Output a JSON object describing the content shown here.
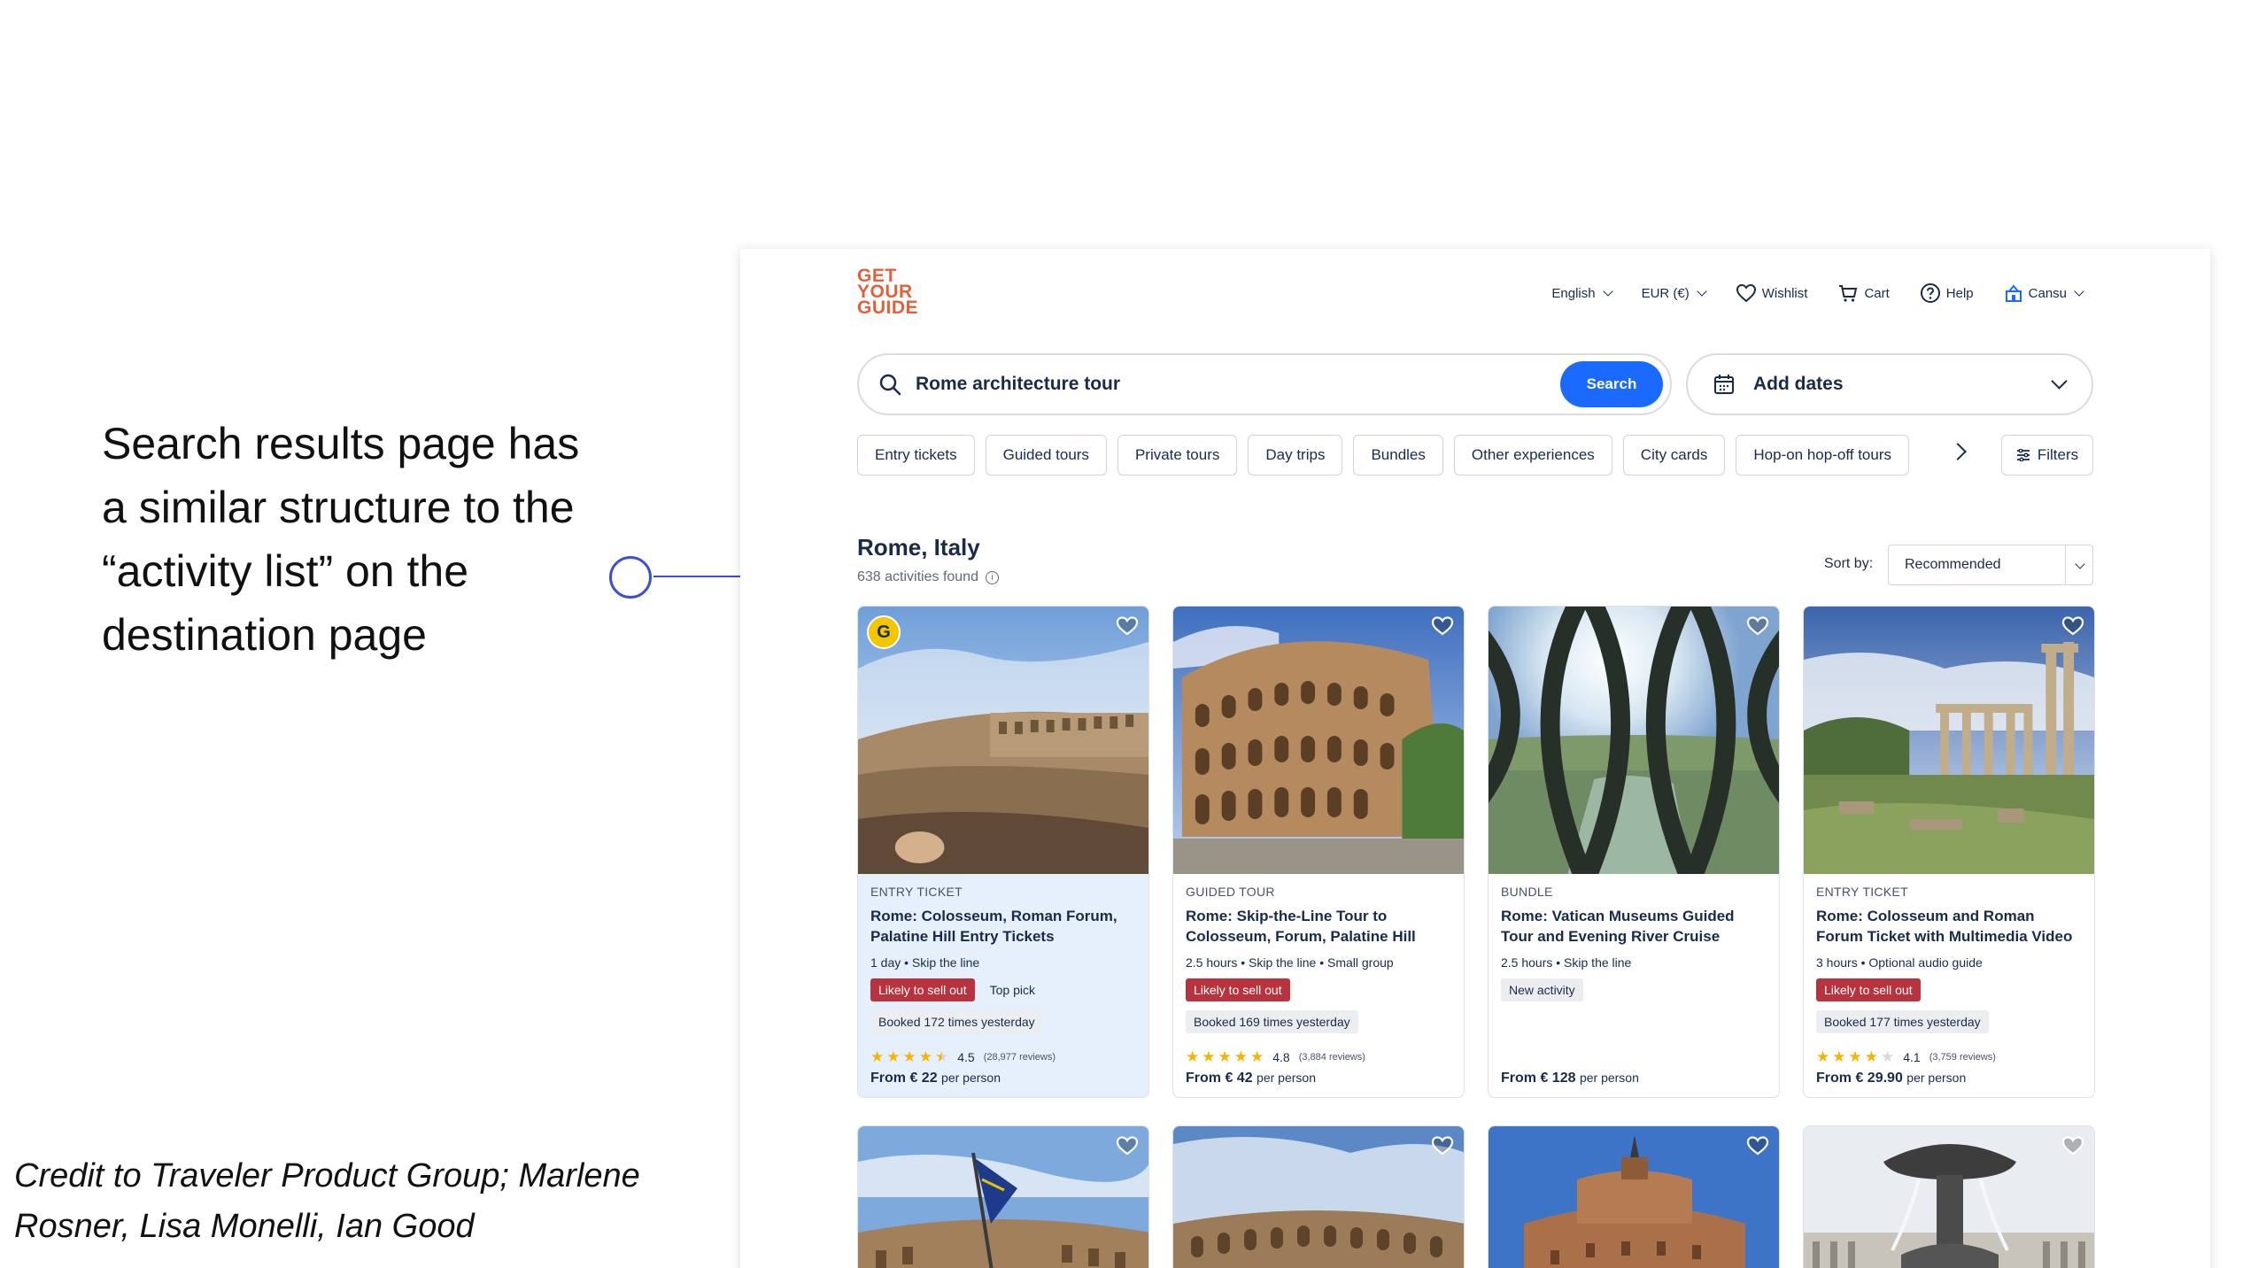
{
  "slide": {
    "caption": "Search results page has a similar structure to the “activity list” on the destination page",
    "credit": "Credit to Traveler Product Group; Marlene Rosner, Lisa Monelli, Ian Good",
    "connector_color": "#3d4fd6"
  },
  "app": {
    "logo_lines": [
      "GET",
      "YOUR",
      "GUIDE"
    ],
    "brand_color": "#e0613b",
    "accent_color": "#1a6aff"
  },
  "header": {
    "language": "English",
    "currency": "EUR (€)",
    "wishlist": "Wishlist",
    "cart": "Cart",
    "help": "Help",
    "user": "Cansu"
  },
  "search": {
    "query": "Rome architecture tour",
    "button_label": "Search",
    "date_label": "Add dates"
  },
  "chips": [
    "Entry tickets",
    "Guided tours",
    "Private tours",
    "Day trips",
    "Bundles",
    "Other experiences",
    "City cards",
    "Hop-on hop-off tours"
  ],
  "filters_label": "Filters",
  "results": {
    "title": "Rome, Italy",
    "count": "638 activities found",
    "sort_label": "Sort by:",
    "sort_value": "Recommended"
  },
  "cards": [
    {
      "category": "ENTRY TICKET",
      "title": "Rome: Colosseum, Roman Forum, Palatine Hill Entry Tickets",
      "meta": "1 day • Skip the line",
      "badge_red": "Likely to sell out",
      "badge_plain": "Top pick",
      "booked": "Booked 172 times yesterday",
      "rating": "4.5",
      "rating_stars": 4.5,
      "reviews": "(28,977 reviews)",
      "price_prefix": "From",
      "price": "€ 22",
      "price_suffix": "per person",
      "highlighted": true,
      "image": "colosseum-interior"
    },
    {
      "category": "GUIDED TOUR",
      "title": "Rome: Skip-the-Line Tour to Colosseum, Forum, Palatine Hill",
      "meta": "2.5 hours • Skip the line • Small group",
      "badge_red": "Likely to sell out",
      "booked": "Booked 169 times yesterday",
      "rating": "4.8",
      "rating_stars": 5,
      "reviews": "(3,884 reviews)",
      "price_prefix": "From",
      "price": "€ 42",
      "price_suffix": "per person",
      "image": "colosseum-exterior"
    },
    {
      "category": "BUNDLE",
      "title": "Rome: Vatican Museums Guided Tour and Evening River Cruise",
      "meta": "2.5 hours • Skip the line",
      "badge_grey": "New activity",
      "price_prefix": "From",
      "price": "€ 128",
      "price_suffix": "per person",
      "image": "river-through-railing"
    },
    {
      "category": "ENTRY TICKET",
      "title": "Rome: Colosseum and Roman Forum Ticket with Multimedia Video",
      "meta": "3 hours • Optional audio guide",
      "badge_red": "Likely to sell out",
      "booked": "Booked 177 times yesterday",
      "rating": "4.1",
      "rating_stars": 4,
      "reviews": "(3,759 reviews)",
      "price_prefix": "From",
      "price": "€ 29.90",
      "price_suffix": "per person",
      "image": "roman-forum-ruins"
    }
  ],
  "second_row_images": [
    "colosseum-with-flag",
    "colosseum-under-clouds",
    "castel-sant-angelo",
    "fountain-st-peters-square"
  ]
}
